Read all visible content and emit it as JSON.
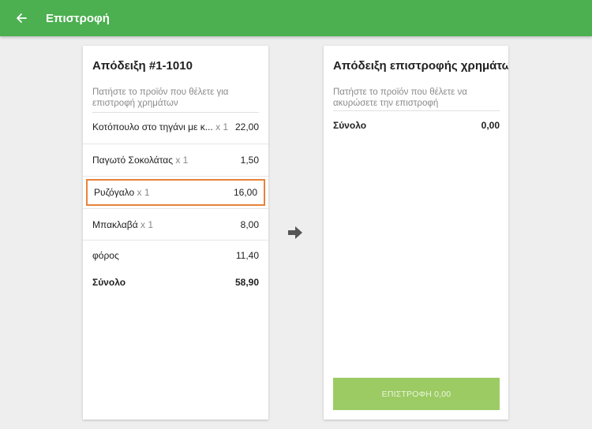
{
  "appbar": {
    "title": "Επιστροφή",
    "back_icon": "arrow-left-icon",
    "color": "#4caf50"
  },
  "receipt": {
    "title": "Απόδειξη #1-1010",
    "hint": "Πατήστε το προϊόν που θέλετε για επιστροφή χρημάτων",
    "items": [
      {
        "name": "Κοτόπουλο στο τηγάνι με κ...",
        "qty": "x 1",
        "price": "22,00"
      },
      {
        "name": "Παγωτό Σοκολάτας",
        "qty": "x 1",
        "price": "1,50"
      },
      {
        "name": "Ρυζόγαλο",
        "qty": "x 1",
        "price": "16,00",
        "selected": true
      },
      {
        "name": "Μπακλαβά",
        "qty": "x 1",
        "price": "8,00"
      }
    ],
    "tax_label": "φόρος",
    "tax_value": "11,40",
    "total_label": "Σύνολο",
    "total_value": "58,90"
  },
  "transfer_icon": "arrow-right-icon",
  "refund": {
    "title": "Απόδειξη επιστροφής χρημάτων",
    "hint": "Πατήστε το προϊόν που θέλετε να ακυρώσετε την επιστροφή",
    "total_label": "Σύνολο",
    "total_value": "0,00",
    "button_label": "ΕΠΙΣΤΡΟΦΗ 0,00"
  },
  "colors": {
    "selected_border": "#e8833a",
    "button": "#8bc34a"
  }
}
